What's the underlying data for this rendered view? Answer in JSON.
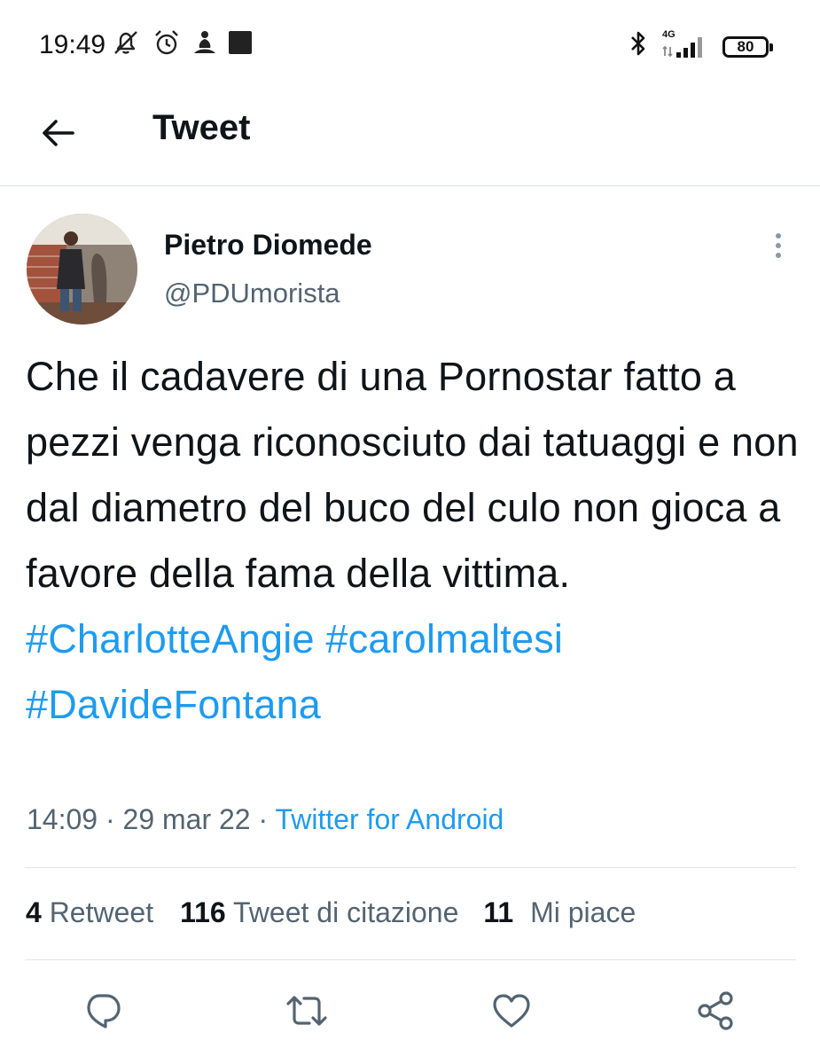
{
  "status_bar": {
    "time": "19:49",
    "network": "4G",
    "battery": "80"
  },
  "header": {
    "title": "Tweet"
  },
  "tweet": {
    "author_name": "Pietro Diomede",
    "author_handle": "@PDUmorista",
    "text": "Che il cadavere di una Pornostar fatto a pezzi venga riconosciuto dai tatuaggi e non dal diametro del buco del culo non gioca a favore della fama della vittima.",
    "hashtags": [
      "#CharlotteAngie",
      "#carolmaltesi",
      "#DavideFontana"
    ],
    "time": "14:09",
    "date": "29 mar 22",
    "separator": "·",
    "source": "Twitter for Android"
  },
  "stats": {
    "retweets_count": "4",
    "retweets_label": "Retweet",
    "quotes_count": "116",
    "quotes_label": "Tweet di citazione",
    "likes_count": "11",
    "likes_label": "Mi piace"
  },
  "colors": {
    "accent": "#1d9bf0",
    "text_primary": "#0f1419",
    "text_secondary": "#536471",
    "divider": "#e1e6ea"
  },
  "icons": {
    "back": "arrow-left-icon",
    "more": "more-vertical-icon",
    "reply": "reply-icon",
    "retweet": "retweet-icon",
    "like": "heart-icon",
    "share": "share-icon"
  }
}
